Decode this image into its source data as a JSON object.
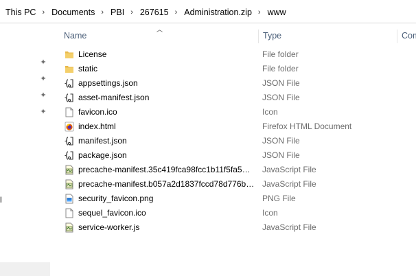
{
  "breadcrumb": [
    "This PC",
    "Documents",
    "PBI",
    "267615",
    "Administration.zip",
    "www"
  ],
  "columns": {
    "name": "Name",
    "type": "Type",
    "comments": "Com"
  },
  "files": [
    {
      "name": "License",
      "type": "File folder",
      "icon": "folder-icon"
    },
    {
      "name": "static",
      "type": "File folder",
      "icon": "folder-icon"
    },
    {
      "name": "appsettings.json",
      "type": "JSON File",
      "icon": "json-file-icon"
    },
    {
      "name": "asset-manifest.json",
      "type": "JSON File",
      "icon": "json-file-icon"
    },
    {
      "name": "favicon.ico",
      "type": "Icon",
      "icon": "blank-file-icon"
    },
    {
      "name": "index.html",
      "type": "Firefox HTML Document",
      "icon": "firefox-html-icon"
    },
    {
      "name": "manifest.json",
      "type": "JSON File",
      "icon": "json-file-icon"
    },
    {
      "name": "package.json",
      "type": "JSON File",
      "icon": "json-file-icon"
    },
    {
      "name": "precache-manifest.35c419fca98fcc1b11f5fa5ac...",
      "type": "JavaScript File",
      "icon": "javascript-file-icon"
    },
    {
      "name": "precache-manifest.b057a2d1837fccd78d776b5...",
      "type": "JavaScript File",
      "icon": "javascript-file-icon"
    },
    {
      "name": "security_favicon.png",
      "type": "PNG File",
      "icon": "png-file-icon"
    },
    {
      "name": "sequel_favicon.ico",
      "type": "Icon",
      "icon": "blank-file-icon"
    },
    {
      "name": "service-worker.js",
      "type": "JavaScript File",
      "icon": "javascript-file-icon"
    }
  ],
  "navpane": {
    "cut_label": "l"
  },
  "colors": {
    "folder": "#e8b84a",
    "header_text": "#4c607a",
    "type_text": "#6d6d6d"
  }
}
